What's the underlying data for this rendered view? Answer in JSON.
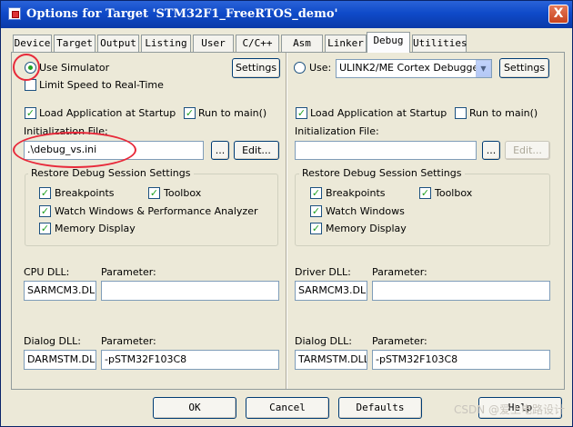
{
  "window": {
    "title": "Options for Target 'STM32F1_FreeRTOS_demo'",
    "close_label": "X"
  },
  "tabs": [
    "Device",
    "Target",
    "Output",
    "Listing",
    "User",
    "C/C++",
    "Asm",
    "Linker",
    "Debug",
    "Utilities"
  ],
  "active_tab": "Debug",
  "left": {
    "use_simulator_label": "Use Simulator",
    "use_simulator_selected": true,
    "settings_label": "Settings",
    "limit_speed_label": "Limit Speed to Real-Time",
    "limit_speed_checked": false,
    "load_app_label": "Load Application at Startup",
    "load_app_checked": true,
    "run_to_main_label": "Run to main()",
    "run_to_main_checked": true,
    "init_file_label": "Initialization File:",
    "init_file_value": ".\\debug_vs.ini",
    "browse_label": "...",
    "edit_label": "Edit...",
    "restore_title": "Restore Debug Session Settings",
    "breakpoints_label": "Breakpoints",
    "breakpoints_checked": true,
    "toolbox_label": "Toolbox",
    "toolbox_checked": true,
    "watch_label": "Watch Windows & Performance Analyzer",
    "watch_checked": true,
    "memory_label": "Memory Display",
    "memory_checked": true,
    "cpu_dll_label": "CPU DLL:",
    "cpu_dll_value": "SARMCM3.DLL",
    "cpu_param_label": "Parameter:",
    "cpu_param_value": "",
    "dialog_dll_label": "Dialog DLL:",
    "dialog_dll_value": "DARMSTM.DLL",
    "dialog_param_label": "Parameter:",
    "dialog_param_value": "-pSTM32F103C8"
  },
  "right": {
    "use_label": "Use:",
    "use_selected": false,
    "debugger_value": "ULINK2/ME Cortex Debugger",
    "settings_label": "Settings",
    "load_app_label": "Load Application at Startup",
    "load_app_checked": true,
    "run_to_main_label": "Run to main()",
    "run_to_main_checked": false,
    "init_file_label": "Initialization File:",
    "init_file_value": "",
    "browse_label": "...",
    "edit_label": "Edit...",
    "restore_title": "Restore Debug Session Settings",
    "breakpoints_label": "Breakpoints",
    "breakpoints_checked": true,
    "toolbox_label": "Toolbox",
    "toolbox_checked": true,
    "watch_label": "Watch Windows",
    "watch_checked": true,
    "memory_label": "Memory Display",
    "memory_checked": true,
    "driver_dll_label": "Driver DLL:",
    "driver_dll_value": "SARMCM3.DLL",
    "driver_param_label": "Parameter:",
    "driver_param_value": "",
    "dialog_dll_label": "Dialog DLL:",
    "dialog_dll_value": "TARMSTM.DLL",
    "dialog_param_label": "Parameter:",
    "dialog_param_value": "-pSTM32F103C8"
  },
  "footer": {
    "ok_label": "OK",
    "cancel_label": "Cancel",
    "defaults_label": "Defaults",
    "help_label": "Help"
  },
  "watermark": "CSDN @爱上电路设计",
  "colors": {
    "titlebar": "#0a3aa8",
    "dialog_bg": "#ece9d8",
    "check_mark": "#21a121",
    "annotation_circle": "#e8293a"
  }
}
